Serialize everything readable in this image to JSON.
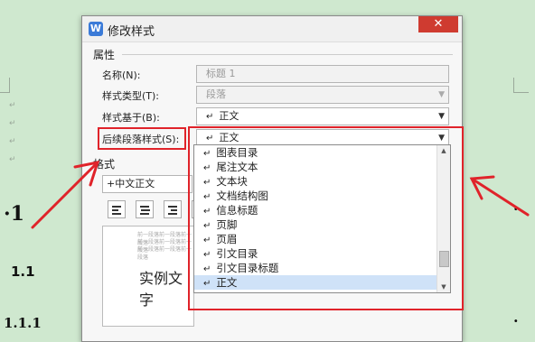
{
  "dialog": {
    "title": "修改样式",
    "app_icon_letter": "W",
    "close_glyph": "✕",
    "section_properties": "属性",
    "fields": {
      "name_label": "名称(N):",
      "name_value": "标题 1",
      "type_label": "样式类型(T):",
      "type_value": "段落",
      "based_on_label": "样式基于(B):",
      "based_on_value": "正文",
      "following_label": "后续段落样式(S):",
      "following_value": "正文"
    },
    "format_label": "格式",
    "font_value": "+中文正文",
    "preview_sample": "实例文字",
    "preview_prev": "前一段落前一段落前一段落"
  },
  "dropdown": {
    "items": [
      "图表目录",
      "尾注文本",
      "文本块",
      "文档结构图",
      "信息标题",
      "页脚",
      "页眉",
      "引文目录",
      "引文目录标题",
      "正文"
    ],
    "selected": "正文"
  },
  "document": {
    "heading_1": "·1",
    "heading_11": "1.1",
    "heading_111": "1.1.1"
  },
  "colors": {
    "annotation": "#e0232a",
    "background": "#cfe8cf",
    "selection": "#cfe2f8"
  }
}
